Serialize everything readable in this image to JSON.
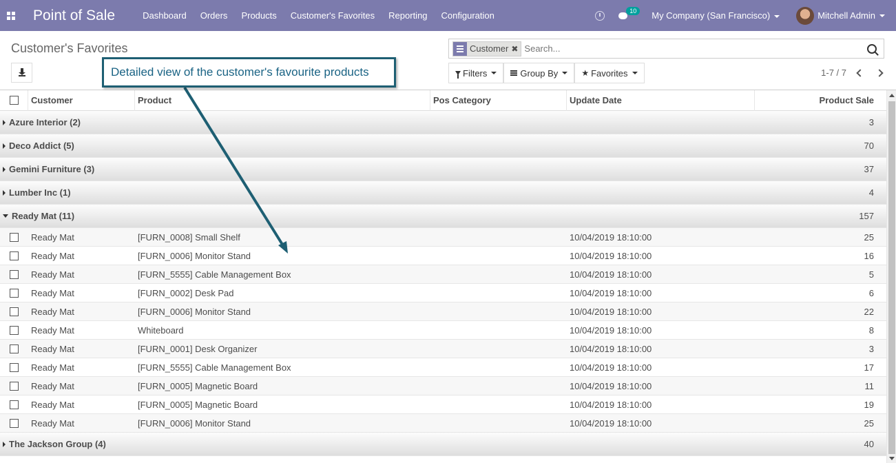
{
  "navbar": {
    "brand": "Point of Sale",
    "menu": [
      "Dashboard",
      "Orders",
      "Products",
      "Customer's Favorites",
      "Reporting",
      "Configuration"
    ],
    "chat_badge": "10",
    "company": "My Company (San Francisco)",
    "user": "Mitchell Admin"
  },
  "control": {
    "breadcrumb": "Customer's Favorites",
    "search": {
      "facet_label": "Customer",
      "placeholder": "Search..."
    },
    "filters_label": "Filters",
    "groupby_label": "Group By",
    "favorites_label": "Favorites",
    "pager": "1-7 / 7"
  },
  "callout": "Detailed view of the customer's favourite products",
  "table": {
    "columns": [
      "Customer",
      "Product",
      "Pos Category",
      "Update Date",
      "Product Sale"
    ],
    "groups_before": [
      {
        "name": "Azure Interior (2)",
        "total": "3"
      },
      {
        "name": "Deco Addict (5)",
        "total": "70"
      },
      {
        "name": "Gemini Furniture (3)",
        "total": "37"
      },
      {
        "name": "Lumber Inc (1)",
        "total": "4"
      }
    ],
    "open_group": {
      "name": "Ready Mat (11)",
      "total": "157"
    },
    "rows": [
      {
        "customer": "Ready Mat",
        "product": "[FURN_0008] Small Shelf",
        "category": "",
        "date": "10/04/2019 18:10:00",
        "sale": "25"
      },
      {
        "customer": "Ready Mat",
        "product": "[FURN_0006] Monitor Stand",
        "category": "",
        "date": "10/04/2019 18:10:00",
        "sale": "16"
      },
      {
        "customer": "Ready Mat",
        "product": "[FURN_5555] Cable Management Box",
        "category": "",
        "date": "10/04/2019 18:10:00",
        "sale": "5"
      },
      {
        "customer": "Ready Mat",
        "product": "[FURN_0002] Desk Pad",
        "category": "",
        "date": "10/04/2019 18:10:00",
        "sale": "6"
      },
      {
        "customer": "Ready Mat",
        "product": "[FURN_0006] Monitor Stand",
        "category": "",
        "date": "10/04/2019 18:10:00",
        "sale": "22"
      },
      {
        "customer": "Ready Mat",
        "product": "Whiteboard",
        "category": "",
        "date": "10/04/2019 18:10:00",
        "sale": "8"
      },
      {
        "customer": "Ready Mat",
        "product": "[FURN_0001] Desk Organizer",
        "category": "",
        "date": "10/04/2019 18:10:00",
        "sale": "3"
      },
      {
        "customer": "Ready Mat",
        "product": "[FURN_5555] Cable Management Box",
        "category": "",
        "date": "10/04/2019 18:10:00",
        "sale": "17"
      },
      {
        "customer": "Ready Mat",
        "product": "[FURN_0005] Magnetic Board",
        "category": "",
        "date": "10/04/2019 18:10:00",
        "sale": "11"
      },
      {
        "customer": "Ready Mat",
        "product": "[FURN_0005] Magnetic Board",
        "category": "",
        "date": "10/04/2019 18:10:00",
        "sale": "19"
      },
      {
        "customer": "Ready Mat",
        "product": "[FURN_0006] Monitor Stand",
        "category": "",
        "date": "10/04/2019 18:10:00",
        "sale": "25"
      }
    ],
    "groups_after": [
      {
        "name": "The Jackson Group (4)",
        "total": "40"
      }
    ]
  },
  "colors": {
    "navbar": "#7c7bad",
    "badge": "#00a09d",
    "callout_border": "#1e5f73",
    "callout_text": "#1a6384"
  }
}
